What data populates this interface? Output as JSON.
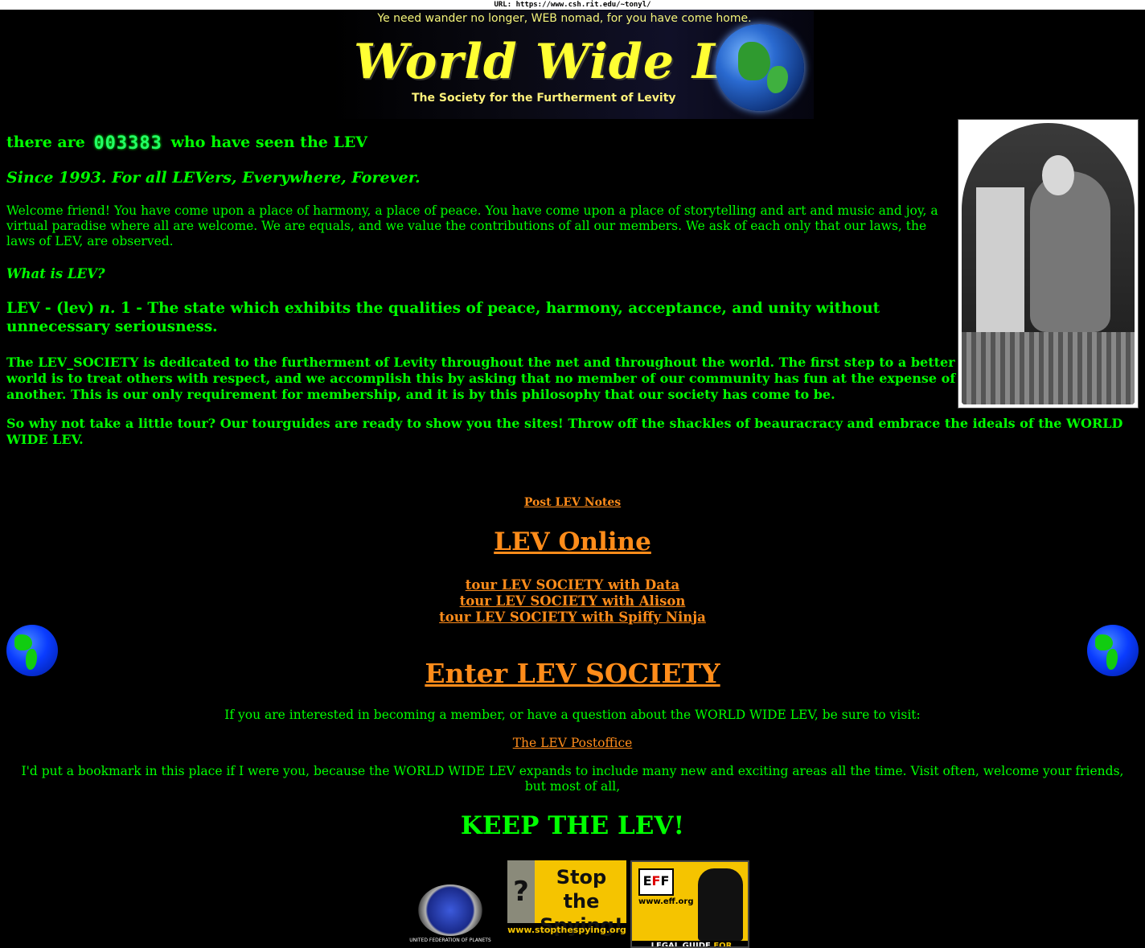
{
  "url_bar": {
    "label": "URL:",
    "url": "https://www.csh.rit.edu/~tonyl/"
  },
  "banner": {
    "tagline_top": "Ye need wander no longer, WEB nomad, for you have come home.",
    "title": "World Wide Lev",
    "tagline_bottom": "The Society for the Furtherment of Levity"
  },
  "counter": {
    "prefix": "there are",
    "value": "003383",
    "suffix": "who have seen the LEV"
  },
  "since": "Since 1993. For all LEVers, Everywhere, Forever.",
  "welcome": "Welcome friend! You have come upon a place of harmony, a place of peace. You have come upon a place of storytelling and art and music and joy, a virtual paradise where all are welcome. We are equals, and we value the contributions of all our members. We ask of each only that our laws, the laws of LEV, are observed.",
  "what_is": "What is LEV?",
  "definition": {
    "term": "LEV - (lev)",
    "pos": "n.",
    "text": "1 - The state which exhibits the qualities of peace, harmony, acceptance, and unity without unnecessary seriousness."
  },
  "dedicated": "The LEV_SOCIETY is dedicated to the furtherment of Levity throughout the net and throughout the world. The first step to a better world is to treat others with respect, and we accomplish this by asking that no member of our community has fun at the expense of another. This is our only requirement for membership, and it is by this philosophy that our society has come to be.",
  "tour_intro": "So why not take a little tour? Our tourguides are ready to show you the sites! Throw off the shackles of beauracracy and embrace the ideals of the WORLD WIDE LEV.",
  "links": {
    "post_notes": "Post LEV Notes",
    "lev_online": "LEV Online",
    "tours": [
      "tour LEV SOCIETY with Data",
      "tour LEV SOCIETY with Alison",
      "tour LEV SOCIETY with Spiffy Ninja"
    ],
    "enter": "Enter LEV SOCIETY",
    "postoffice": "The LEV Postoffice"
  },
  "interest": "If you are interested in becoming a member, or have a question about the WORLD WIDE LEV, be sure to visit:",
  "bookmark": "I'd put a bookmark in this place if I were you, because the WORLD WIDE LEV expands to include many new and exciting areas all the time. Visit often, welcome your friends, but most of all,",
  "keep": "KEEP THE LEV!",
  "badges": {
    "ufp": "UNITED FEDERATION OF PLANETS",
    "spy_title": "Stop the Spying!",
    "spy_url": "www.stopthespying.org",
    "eff_url": "www.eff.org",
    "eff_footer_a": "LEGAL GUIDE",
    "eff_footer_b": "FOR BLOGGERS"
  },
  "colors": {
    "background": "#000000",
    "text": "#00ff00",
    "link": "#ff8c1a"
  },
  "icons": [
    "earth-globe-icon",
    "earth-globe-icon"
  ]
}
